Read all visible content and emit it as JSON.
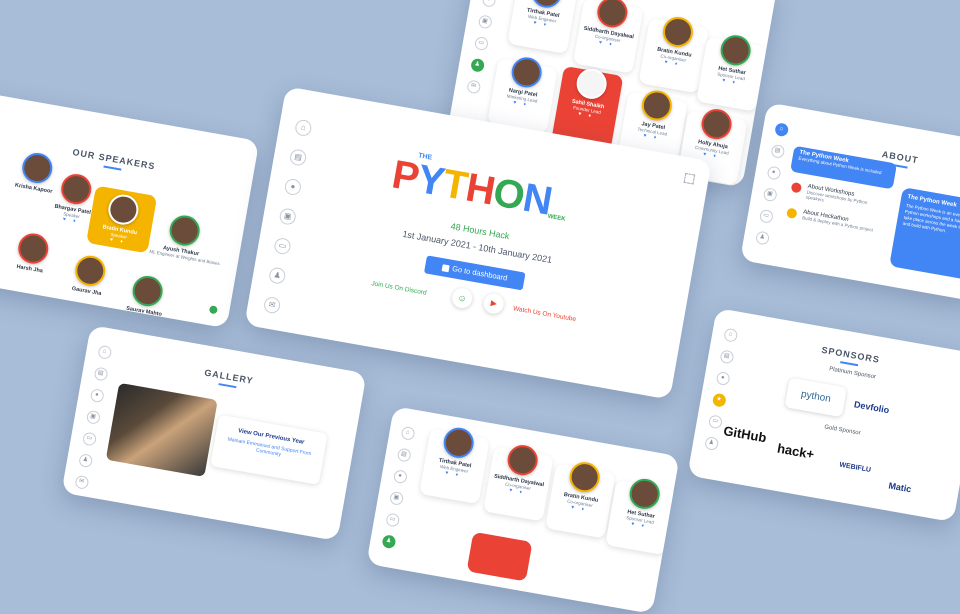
{
  "hero": {
    "logo_the": "THE",
    "logo_letters": [
      "P",
      "Y",
      "T",
      "H",
      "O",
      "N"
    ],
    "logo_week": "WEEK",
    "subtitle": "48 Hours Hack",
    "dates": "1st January 2021 - 10th January 2021",
    "cta_label": "Go to dashboard",
    "discord_label": "Join Us On Discord",
    "youtube_label": "Watch Us On Youtube"
  },
  "speakers": {
    "title": "OUR SPEAKERS",
    "people": [
      {
        "name": "Krisha Kapoor",
        "role": "Speaker"
      },
      {
        "name": "Bhargav Patel",
        "role": "Speaker"
      },
      {
        "name": "Bratin Kundu",
        "role": "Speaker"
      },
      {
        "name": "Ayush Thakur",
        "role": "ML Engineer at Weights and Biases"
      },
      {
        "name": "Harsh Jha",
        "role": "Speaker"
      },
      {
        "name": "Gaurav Jha",
        "role": "Speaker"
      },
      {
        "name": "Saurav Mahto",
        "role": "Speaker"
      }
    ]
  },
  "team_top": {
    "people": [
      {
        "name": "Tirthak Patel",
        "role": "Web Engineer"
      },
      {
        "name": "Siddharth Dayalwal",
        "role": "Co-organiser"
      },
      {
        "name": "Bratin Kundu",
        "role": "Co-organiser"
      },
      {
        "name": "Het Suthar",
        "role": "Sponsor Lead"
      },
      {
        "name": "Nargi Patel",
        "role": "Marketing Lead"
      },
      {
        "name": "Sahil Shaikh",
        "role": "Founder Lead"
      },
      {
        "name": "Jay Patel",
        "role": "Technical Lead"
      },
      {
        "name": "Holly Ahuja",
        "role": "Community Lead"
      }
    ]
  },
  "about": {
    "title": "ABOUT",
    "items": [
      {
        "label": "The Python Week",
        "sub": "Everything about Python Week is included"
      },
      {
        "label": "About Workshops",
        "sub": "Discover workshops by Python speakers"
      },
      {
        "label": "About Hackathon",
        "sub": "Build & deploy with a Python project"
      }
    ],
    "panel_title": "The Python Week",
    "panel_text": "The Python Week is an event where Python workshops and a hackathon take place across the week to learn and build with Python."
  },
  "sponsors": {
    "title": "SPONSORS",
    "platinum_label": "Platinum Sponsor",
    "gold_label": "Gold Sponsor",
    "platinum": [
      "python",
      "Devfolio"
    ],
    "gold": [
      "GitHub",
      "hack+",
      "WEBIFLU",
      "Matic"
    ]
  },
  "gallery": {
    "title": "GALLERY",
    "caption_title": "View Our Previous Year",
    "caption_text": "Mainam Emmanuel and Support From Community"
  },
  "team_bottom": {
    "people": [
      {
        "name": "Tirthak Patel",
        "role": "Web Engineer"
      },
      {
        "name": "Siddharth Dayalwal",
        "role": "Co-organiser"
      },
      {
        "name": "Bratin Kundu",
        "role": "Co-organiser"
      },
      {
        "name": "Het Suthar",
        "role": "Sponsor Lead"
      }
    ]
  },
  "colors": {
    "background": "#a8bdd8",
    "blue": "#4285f4",
    "red": "#ea4335",
    "yellow": "#f4b400",
    "green": "#34a853"
  }
}
